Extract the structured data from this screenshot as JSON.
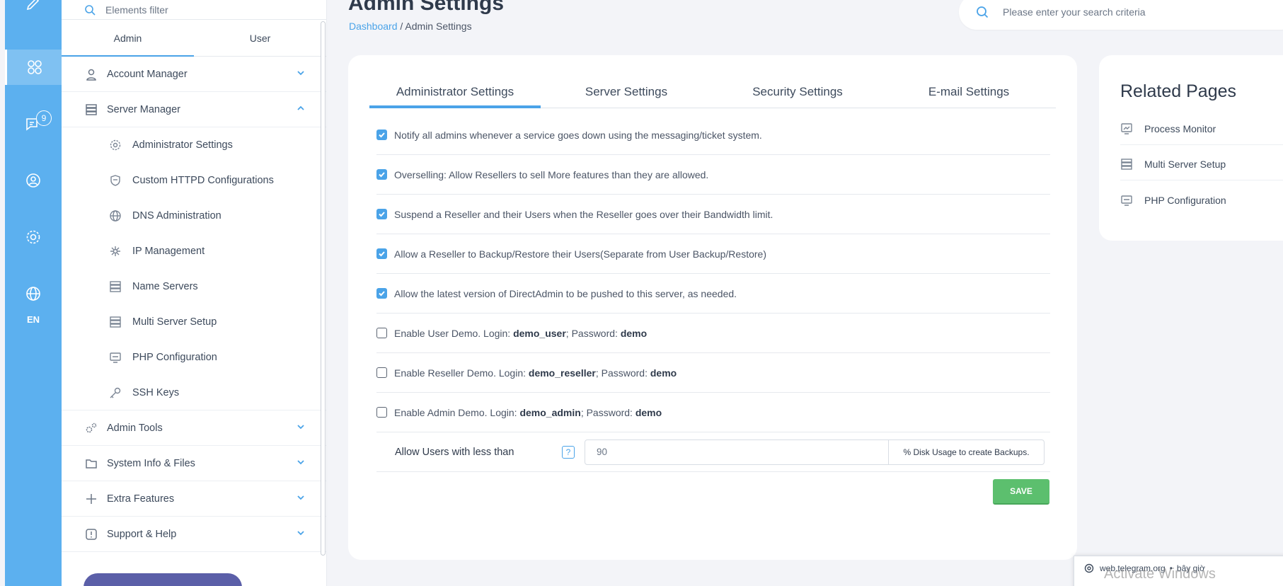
{
  "rail": {
    "lang": "EN",
    "messages_badge": "9",
    "icons": [
      "edit-icon",
      "dashboard-icon",
      "messages-icon",
      "user-icon",
      "settings-icon",
      "globe-icon"
    ]
  },
  "sidebar": {
    "filter_placeholder": "Elements filter",
    "role_tabs": [
      "Admin",
      "User"
    ],
    "items": [
      {
        "label": "Account Manager",
        "icon": "user-icon",
        "expanded": false
      },
      {
        "label": "Server Manager",
        "icon": "server-icon",
        "expanded": true
      },
      {
        "label": "Admin Tools",
        "icon": "gears-icon",
        "expanded": false
      },
      {
        "label": "System Info & Files",
        "icon": "folder-icon",
        "expanded": false
      },
      {
        "label": "Extra Features",
        "icon": "plus-icon",
        "expanded": false
      },
      {
        "label": "Support & Help",
        "icon": "alert-icon",
        "expanded": false
      }
    ],
    "server_manager_sub": [
      {
        "label": "Administrator Settings",
        "icon": "gear-icon"
      },
      {
        "label": "Custom HTTPD Configurations",
        "icon": "shield-icon"
      },
      {
        "label": "DNS Administration",
        "icon": "globe-icon"
      },
      {
        "label": "IP Management",
        "icon": "network-icon"
      },
      {
        "label": "Name Servers",
        "icon": "server-icon"
      },
      {
        "label": "Multi Server Setup",
        "icon": "servers-icon"
      },
      {
        "label": "PHP Configuration",
        "icon": "php-icon"
      },
      {
        "label": "SSH Keys",
        "icon": "key-icon"
      }
    ]
  },
  "header": {
    "title": "Admin Settings",
    "breadcrumb_root": "Dashboard",
    "breadcrumb_sep": " / ",
    "breadcrumb_current": "Admin Settings",
    "search_placeholder": "Please enter your search criteria"
  },
  "tabs": [
    "Administrator Settings",
    "Server Settings",
    "Security Settings",
    "E-mail Settings"
  ],
  "settings": [
    {
      "checked": true,
      "text": "Notify all admins whenever a service goes down using the messaging/ticket system."
    },
    {
      "checked": true,
      "text": "Overselling: Allow Resellers to sell More features than they are allowed."
    },
    {
      "checked": true,
      "text": "Suspend a Reseller and their Users when the Reseller goes over their Bandwidth limit."
    },
    {
      "checked": true,
      "text": "Allow a Reseller to Backup/Restore their Users(Separate from User Backup/Restore)"
    },
    {
      "checked": true,
      "text": "Allow the latest version of DirectAdmin to be pushed to this server, as needed."
    }
  ],
  "demos": [
    {
      "checked": false,
      "prefix": "Enable User Demo. Login: ",
      "login": "demo_user",
      "mid": "; Password: ",
      "password": "demo"
    },
    {
      "checked": false,
      "prefix": "Enable Reseller Demo. Login: ",
      "login": "demo_reseller",
      "mid": "; Password: ",
      "password": "demo"
    },
    {
      "checked": false,
      "prefix": "Enable Admin Demo. Login: ",
      "login": "demo_admin",
      "mid": "; Password: ",
      "password": "demo"
    }
  ],
  "backup": {
    "label": "Allow Users with less than",
    "help": "?",
    "value": "90",
    "suffix": "% Disk Usage to create Backups."
  },
  "save_label": "SAVE",
  "related": {
    "title": "Related Pages",
    "items": [
      {
        "label": "Process Monitor",
        "icon": "monitor-icon"
      },
      {
        "label": "Multi Server Setup",
        "icon": "servers-icon"
      },
      {
        "label": "PHP Configuration",
        "icon": "php-icon"
      }
    ]
  },
  "toast": {
    "source": "web.telegram.org",
    "time": "bây giờ"
  },
  "watermark": "Activate Windows"
}
